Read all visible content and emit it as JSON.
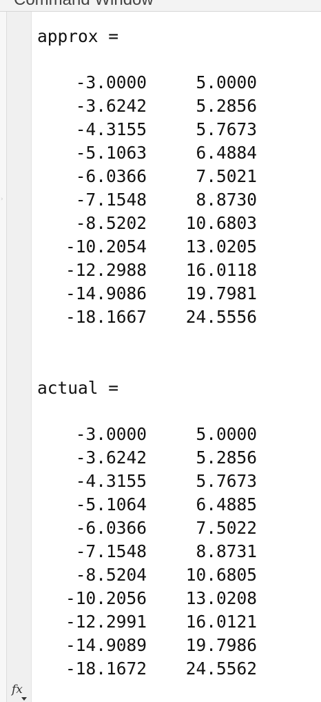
{
  "window": {
    "title": "Command Window"
  },
  "outputs": [
    {
      "label": "approx =",
      "rows": [
        [
          "-3.0000",
          "5.0000"
        ],
        [
          "-3.6242",
          "5.2856"
        ],
        [
          "-4.3155",
          "5.7673"
        ],
        [
          "-5.1063",
          "6.4884"
        ],
        [
          "-6.0366",
          "7.5021"
        ],
        [
          "-7.1548",
          "8.8730"
        ],
        [
          "-8.5202",
          "10.6803"
        ],
        [
          "-10.2054",
          "13.0205"
        ],
        [
          "-12.2988",
          "16.0118"
        ],
        [
          "-14.9086",
          "19.7981"
        ],
        [
          "-18.1667",
          "24.5556"
        ]
      ]
    },
    {
      "label": "actual =",
      "rows": [
        [
          "-3.0000",
          "5.0000"
        ],
        [
          "-3.6242",
          "5.2856"
        ],
        [
          "-4.3155",
          "5.7673"
        ],
        [
          "-5.1064",
          "6.4885"
        ],
        [
          "-6.0366",
          "7.5022"
        ],
        [
          "-7.1548",
          "8.8731"
        ],
        [
          "-8.5204",
          "10.6805"
        ],
        [
          "-10.2056",
          "13.0208"
        ],
        [
          "-12.2991",
          "16.0121"
        ],
        [
          "-14.9089",
          "19.7986"
        ],
        [
          "-18.1672",
          "24.5562"
        ]
      ]
    }
  ],
  "prompt": {
    "icon": "fx"
  }
}
